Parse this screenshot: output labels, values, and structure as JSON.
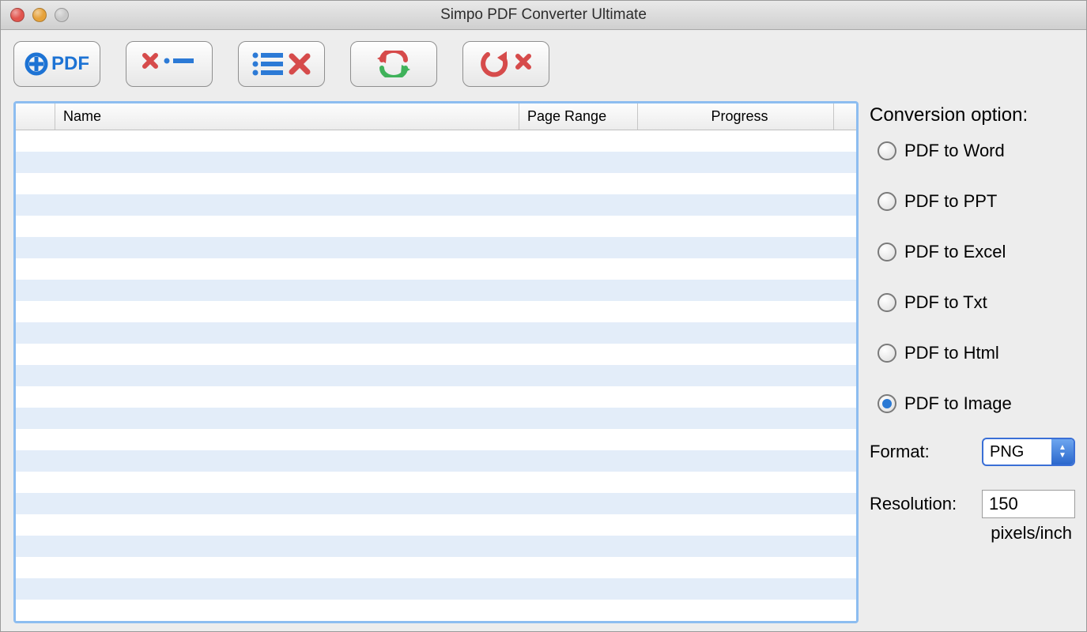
{
  "window": {
    "title": "Simpo PDF Converter Ultimate"
  },
  "toolbar": {
    "add_label": "PDF"
  },
  "table": {
    "columns": {
      "name": "Name",
      "page_range": "Page Range",
      "progress": "Progress"
    },
    "rows": []
  },
  "side": {
    "title": "Conversion option:",
    "options": [
      {
        "label": "PDF to Word",
        "selected": false
      },
      {
        "label": "PDF to PPT",
        "selected": false
      },
      {
        "label": "PDF to Excel",
        "selected": false
      },
      {
        "label": "PDF to Txt",
        "selected": false
      },
      {
        "label": "PDF to Html",
        "selected": false
      },
      {
        "label": "PDF to Image",
        "selected": true
      }
    ],
    "format_label": "Format:",
    "format_value": "PNG",
    "resolution_label": "Resolution:",
    "resolution_value": "150",
    "resolution_unit": "pixels/inch"
  }
}
